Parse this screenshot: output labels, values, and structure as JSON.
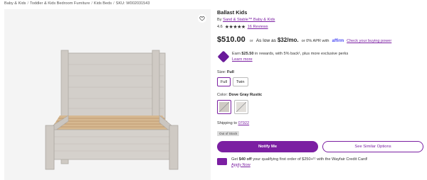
{
  "breadcrumb": {
    "items": [
      "Baby & Kids",
      "Toddler & Kids Bedroom Furniture",
      "Kids Beds"
    ],
    "sku": "SKU: W002031543",
    "separator": "/"
  },
  "product": {
    "title": "Ballast Kids",
    "by_prefix": "By",
    "brand": "Sand & Stable™ Baby & Kids",
    "rating": "4.6",
    "stars": "★★★★★",
    "reviews": "16 Reviews"
  },
  "pricing": {
    "price": "$510.00",
    "or_text": "or",
    "as_low_as": "As low as",
    "monthly": "$32/mo.",
    "apr_text": "or 0% APR with",
    "affirm": "affirm",
    "check_power": "Check your buying power"
  },
  "rewards": {
    "earn": "Earn",
    "amount": "$25.50",
    "rest": "in rewards, with 5% back¹, plus more exclusive perks",
    "learn_more": "Learn more"
  },
  "size": {
    "label": "Size:",
    "selected": "Full",
    "options": [
      "Full",
      "Twin"
    ]
  },
  "color": {
    "label": "Color:",
    "selected": "Dove Gray Rustic"
  },
  "shipping": {
    "label": "Shipping to",
    "zip": "07922",
    "status": "Out of Stock"
  },
  "buttons": {
    "notify": "Notify Me",
    "similar": "See Similar Options"
  },
  "credit": {
    "get": "Get",
    "amount": "$40 off",
    "rest": "your qualifying first order of $250+¹¹ with the Wayfair Credit Card!",
    "apply": "Apply Now"
  },
  "colors": {
    "accent": "#7b1fa2",
    "bed_wood": "#cfcac4",
    "slat": "#d2b48c"
  },
  "icons": {
    "favorite": "heart-icon",
    "rewards": "rewards-gem-icon",
    "card": "credit-card-icon"
  }
}
